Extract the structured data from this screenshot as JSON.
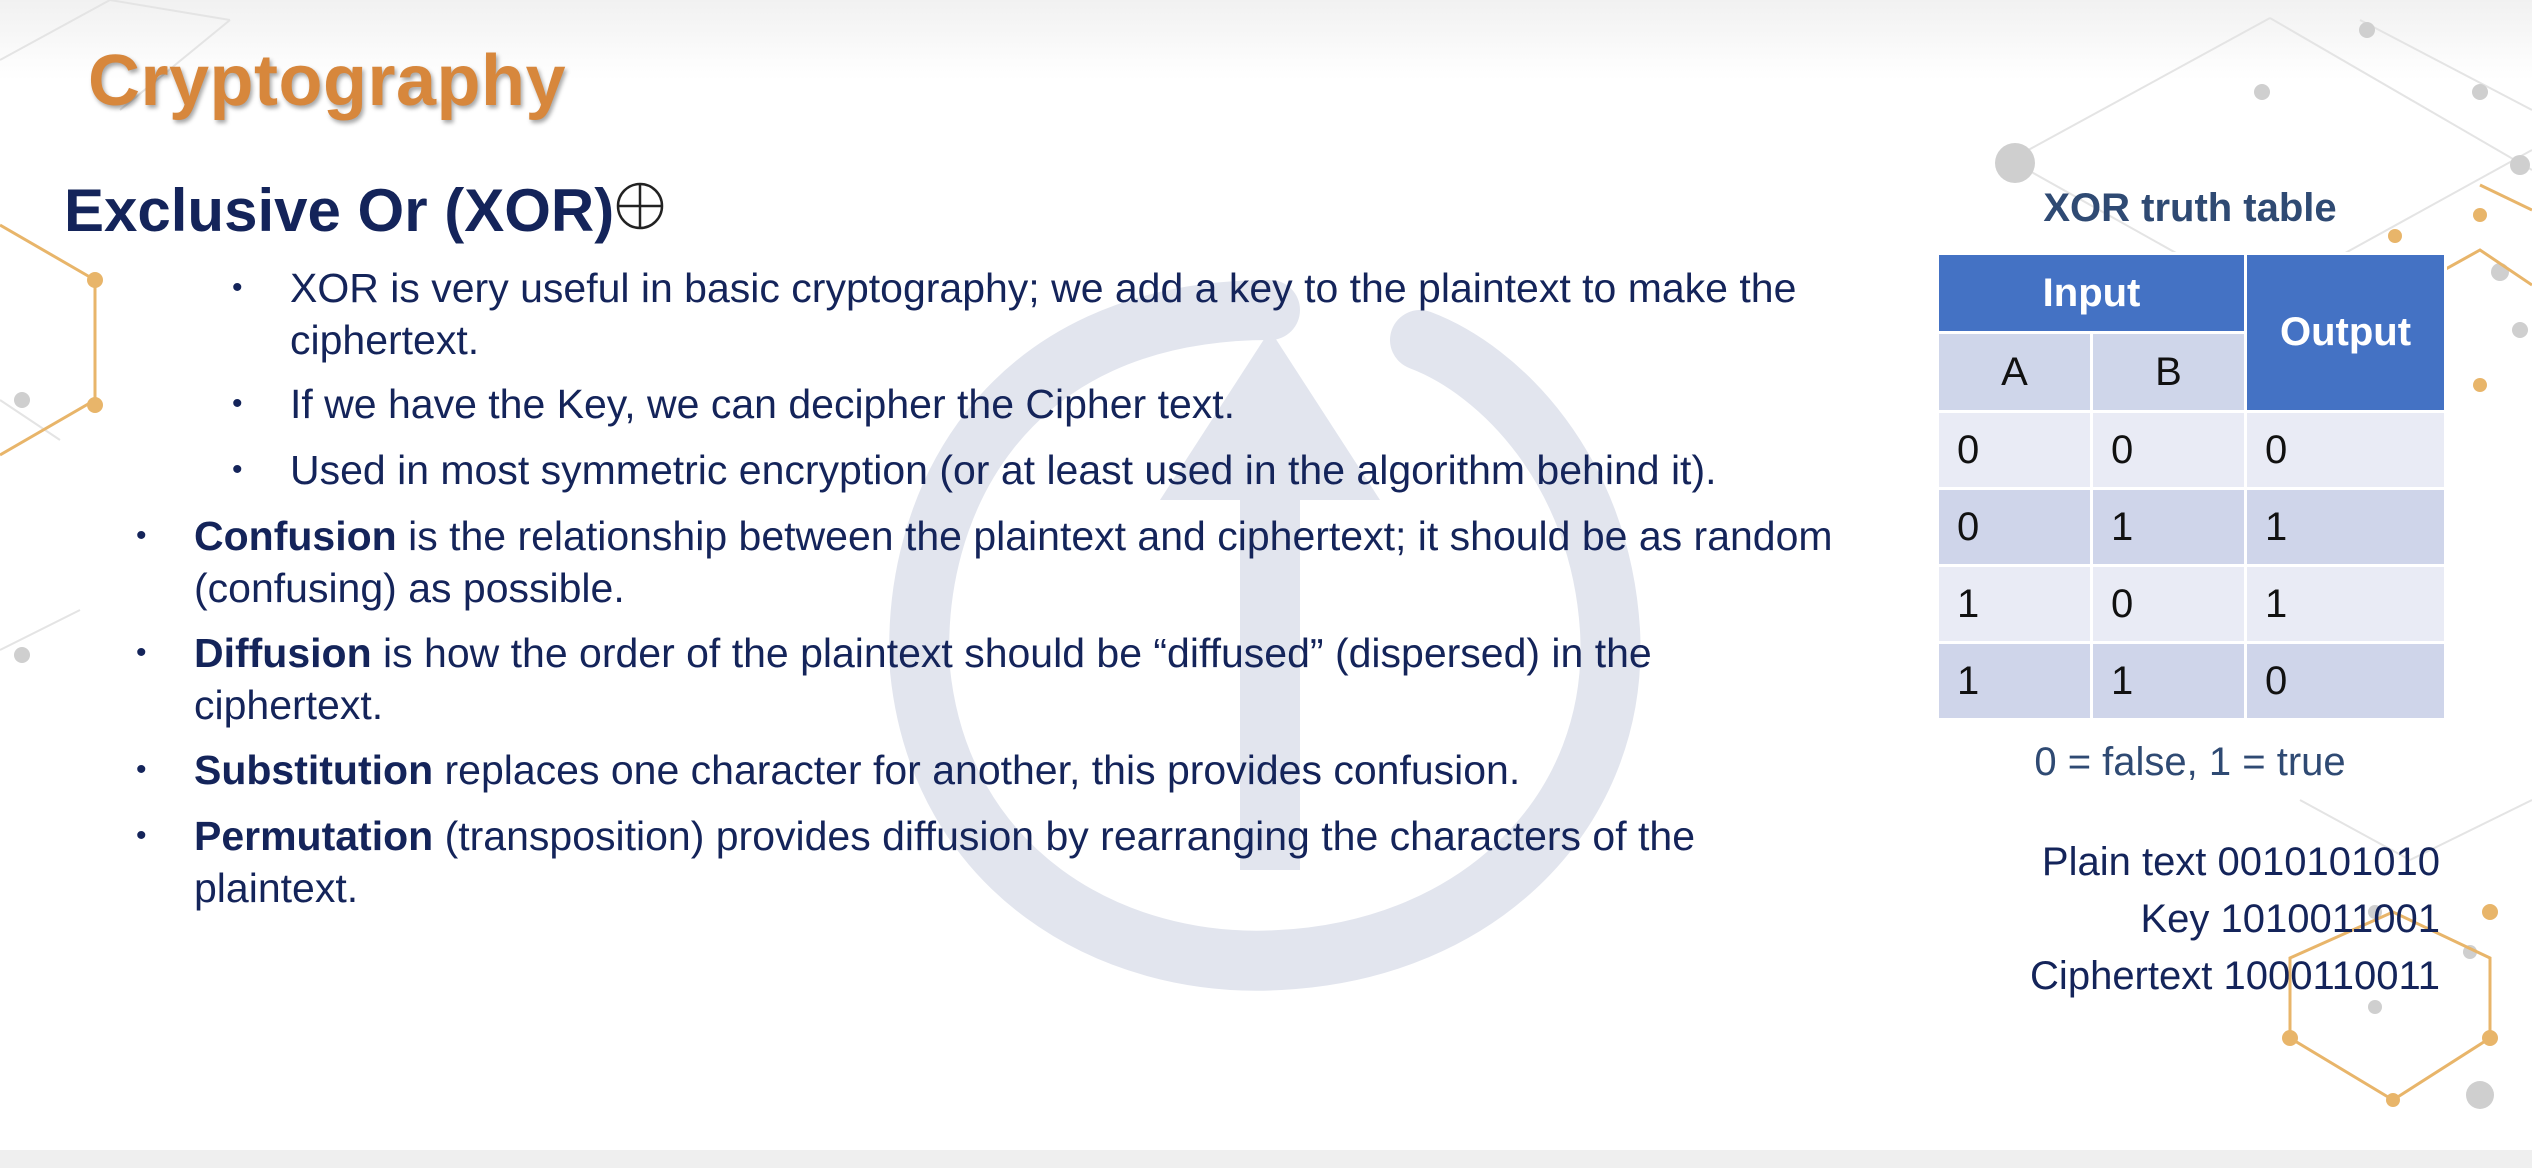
{
  "slide": {
    "title": "Cryptography",
    "subtitle": "Exclusive Or (XOR)",
    "bullet_glyph": "•",
    "icons": {
      "move_icon": "crosshair-move-icon",
      "watermark": "logo-watermark"
    }
  },
  "bullets": [
    {
      "level": 2,
      "bold": "",
      "text": "XOR is very useful in basic cryptography; we add a key to the plaintext to make the ciphertext."
    },
    {
      "level": 2,
      "bold": "",
      "text": "If we have the Key, we can decipher the Cipher text."
    },
    {
      "level": 2,
      "bold": "",
      "text": "Used in most symmetric encryption (or at least used in the algorithm behind it)."
    },
    {
      "level": 1,
      "bold": "Confusion",
      "text": " is the relationship between the plaintext and ciphertext; it should be as random (confusing) as possible."
    },
    {
      "level": 1,
      "bold": "Diffusion",
      "text": " is how the order of the plaintext should be “diffused” (dispersed) in the ciphertext."
    },
    {
      "level": 1,
      "bold": "Substitution",
      "text": " replaces one character for another, this provides confusion."
    },
    {
      "level": 1,
      "bold": "Permutation",
      "text": " (transposition) provides diffusion by rearranging the characters of the plaintext."
    }
  ],
  "truth_table": {
    "title": "XOR truth table",
    "header_input": "Input",
    "header_output": "Output",
    "col_a": "A",
    "col_b": "B",
    "rows": [
      [
        "0",
        "0",
        "0"
      ],
      [
        "0",
        "1",
        "1"
      ],
      [
        "1",
        "0",
        "1"
      ],
      [
        "1",
        "1",
        "0"
      ]
    ],
    "colors": {
      "header": "#4472c4",
      "row_light": "#e9ebf5",
      "row_dark": "#cfd5ea"
    }
  },
  "legend_note": "0 = false, 1 = true",
  "example": {
    "plain_text": "Plain text 0010101010",
    "key": "Key 1010011001",
    "ciphertext": "Ciphertext 1000110011"
  },
  "colors": {
    "title": "#d7873c",
    "text": "#14245a",
    "accent_orange": "#e8b56a",
    "network_gray": "#cfcfcf"
  }
}
